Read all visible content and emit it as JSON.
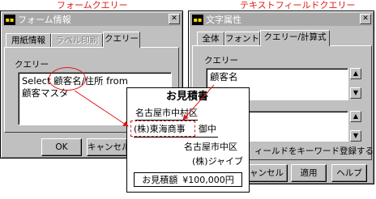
{
  "captions": {
    "left": "フォームクエリー",
    "right": "テキストフィールドクエリー"
  },
  "left_window": {
    "title": "フォーム情報",
    "tabs": [
      "用紙情報",
      "ラベル印刷",
      "クエリー"
    ],
    "group_label": "クエリー",
    "query_lines": [
      "Select 顧客名/住所 from",
      "顧客マスタ"
    ],
    "buttons": {
      "ok": "OK",
      "cancel": "キャンセル"
    }
  },
  "right_window": {
    "title": "文字属性",
    "tabs": [
      "全体",
      "フォント",
      "クエリー/計算式"
    ],
    "group_label": "クエリー",
    "query_value": "顧客名",
    "option_label": "ィールドをキーワード登録する",
    "buttons": {
      "cancel": "ャンセル",
      "apply": "適用",
      "help": "ヘルプ"
    }
  },
  "document": {
    "title": "お見積書",
    "address": "名古屋市中村区",
    "customer": "(株)東海商事",
    "honorific": "御中",
    "sender_address": "名古屋市中区",
    "sender_name": "(株)ジャイブ",
    "amount_label": "お見積額",
    "amount_value": "¥100,000円"
  },
  "accent_color": "#e01818",
  "icons": {
    "app": "app-window-icon",
    "close": "close-icon",
    "spin_up": "spin-up-arrow-icon",
    "spin_down": "spin-down-arrow-icon"
  }
}
